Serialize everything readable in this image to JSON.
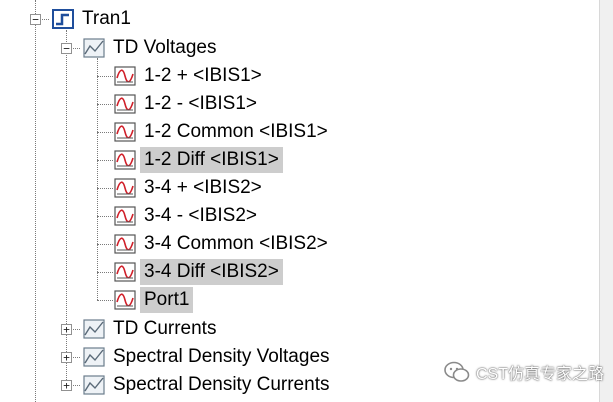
{
  "tree": {
    "root": {
      "label": "Tran1",
      "icon": "transient-result-icon",
      "expanded": true
    },
    "groups": [
      {
        "label": "TD Voltages",
        "icon": "td-chart-icon",
        "expanded": true,
        "items": [
          {
            "label": "1-2 + <IBIS1>",
            "icon": "signal-curve-icon",
            "selected": false
          },
          {
            "label": "1-2 - <IBIS1>",
            "icon": "signal-curve-icon",
            "selected": false
          },
          {
            "label": "1-2 Common <IBIS1>",
            "icon": "signal-curve-icon",
            "selected": false
          },
          {
            "label": "1-2 Diff <IBIS1>",
            "icon": "signal-curve-icon",
            "selected": true
          },
          {
            "label": "3-4 + <IBIS2>",
            "icon": "signal-curve-icon",
            "selected": false
          },
          {
            "label": "3-4 - <IBIS2>",
            "icon": "signal-curve-icon",
            "selected": false
          },
          {
            "label": "3-4 Common <IBIS2>",
            "icon": "signal-curve-icon",
            "selected": false
          },
          {
            "label": "3-4 Diff <IBIS2>",
            "icon": "signal-curve-icon",
            "selected": true
          },
          {
            "label": "Port1",
            "icon": "signal-curve-icon",
            "selected": true
          }
        ]
      },
      {
        "label": "TD Currents",
        "icon": "td-chart-icon",
        "expanded": false
      },
      {
        "label": "Spectral Density Voltages",
        "icon": "td-chart-icon",
        "expanded": false
      },
      {
        "label": "Spectral Density Currents",
        "icon": "td-chart-icon",
        "expanded": false
      }
    ]
  },
  "watermark": {
    "text": "CST仿真专家之路",
    "icon": "wechat-icon"
  },
  "colors": {
    "selection": "#cdcdcd",
    "accent_blue": "#1f4e9c",
    "curve_red": "#d0202a"
  }
}
